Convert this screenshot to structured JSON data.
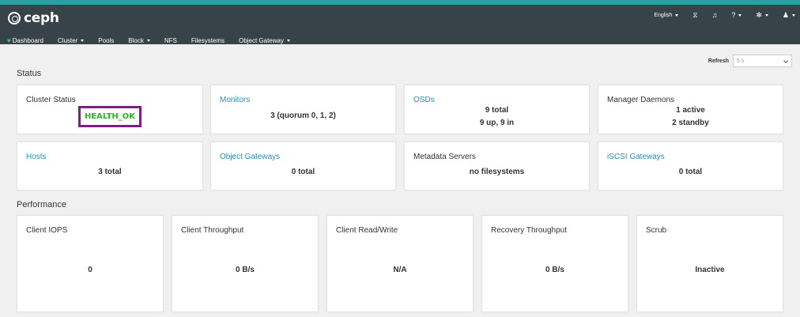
{
  "brand": {
    "name": "ceph"
  },
  "utility": {
    "language": "English",
    "items": [
      {
        "icon": "hourglass-icon"
      },
      {
        "icon": "bell-icon"
      },
      {
        "icon": "help-icon"
      },
      {
        "icon": "gear-icon"
      },
      {
        "icon": "user-icon"
      }
    ]
  },
  "nav": {
    "items": [
      {
        "label": "Dashboard"
      },
      {
        "label": "Cluster"
      },
      {
        "label": "Pools"
      },
      {
        "label": "Block"
      },
      {
        "label": "NFS"
      },
      {
        "label": "Filesystems"
      },
      {
        "label": "Object Gateway"
      }
    ]
  },
  "refresh": {
    "label": "Refresh",
    "value": "5 s"
  },
  "status": {
    "title": "Status",
    "cards": [
      {
        "title": "Cluster Status",
        "value": "HEALTH_OK"
      },
      {
        "title": "Monitors",
        "value": "3 (quorum 0, 1, 2)"
      },
      {
        "title": "OSDs",
        "line1": "9 total",
        "line2": "9 up, 9 in"
      },
      {
        "title": "Manager Daemons",
        "line1": "1 active",
        "line2": "2 standby"
      },
      {
        "title": "Hosts",
        "value": "3 total"
      },
      {
        "title": "Object Gateways",
        "value": "0 total"
      },
      {
        "title": "Metadata Servers",
        "value": "no filesystems"
      },
      {
        "title": "iSCSI Gateways",
        "value": "0 total"
      }
    ]
  },
  "performance": {
    "title": "Performance",
    "cards": [
      {
        "title": "Client IOPS",
        "value": "0"
      },
      {
        "title": "Client Throughput",
        "value": "0 B/s"
      },
      {
        "title": "Client Read/Write",
        "value": "N/A"
      },
      {
        "title": "Recovery Throughput",
        "value": "0 B/s"
      },
      {
        "title": "Scrub",
        "value": "Inactive"
      }
    ]
  },
  "colors": {
    "navbar": "#374249",
    "accent": "#2aa0a6",
    "link": "#2a8fbd",
    "health_ok": "#2bb524",
    "highlight_border": "#7a1f84"
  }
}
